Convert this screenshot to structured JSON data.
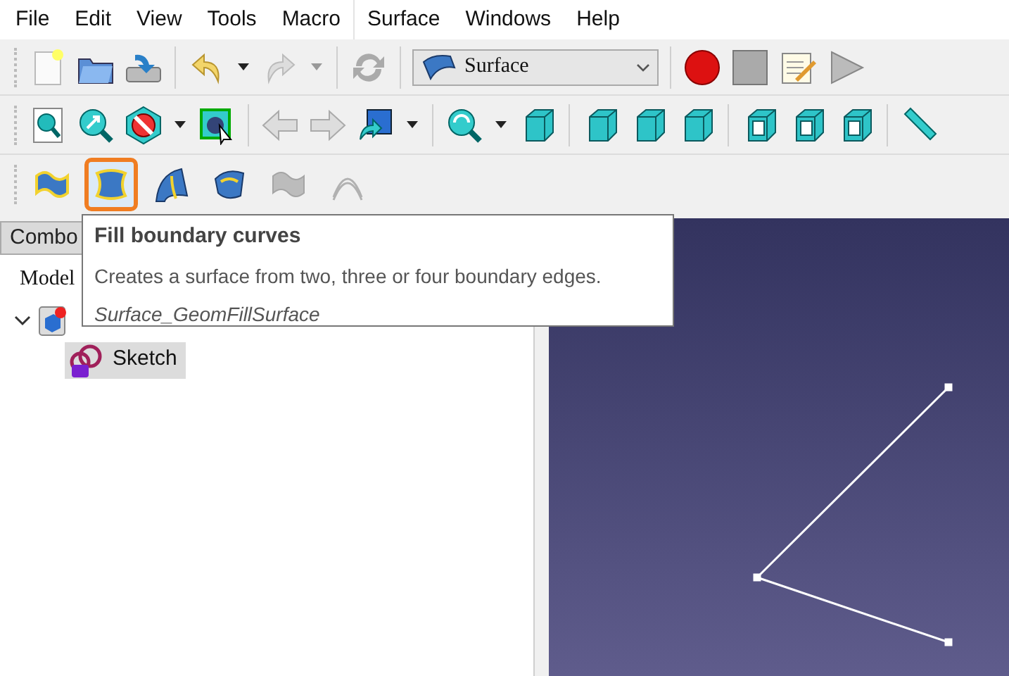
{
  "menu_bar": [
    "File",
    "Edit",
    "View",
    "Tools",
    "Macro",
    "Surface",
    "Windows",
    "Help"
  ],
  "workbench_selector": {
    "value": "Surface"
  },
  "surface_tools": [
    {
      "selected": false,
      "disabled": false
    },
    {
      "selected": true,
      "disabled": false
    },
    {
      "selected": false,
      "disabled": false
    },
    {
      "selected": false,
      "disabled": false
    },
    {
      "selected": false,
      "disabled": true
    },
    {
      "selected": false,
      "disabled": true
    }
  ],
  "tooltip": {
    "title": "Fill boundary curves",
    "description": "Creates a surface from two, three or four boundary edges.",
    "command": "Surface_GeomFillSurface"
  },
  "combo_view": {
    "tab": "Combo",
    "subtab": "Model",
    "tree": [
      {
        "expanded": true,
        "selected": false,
        "children": [
          {
            "label": "Sketch",
            "selected": true
          }
        ]
      }
    ]
  }
}
